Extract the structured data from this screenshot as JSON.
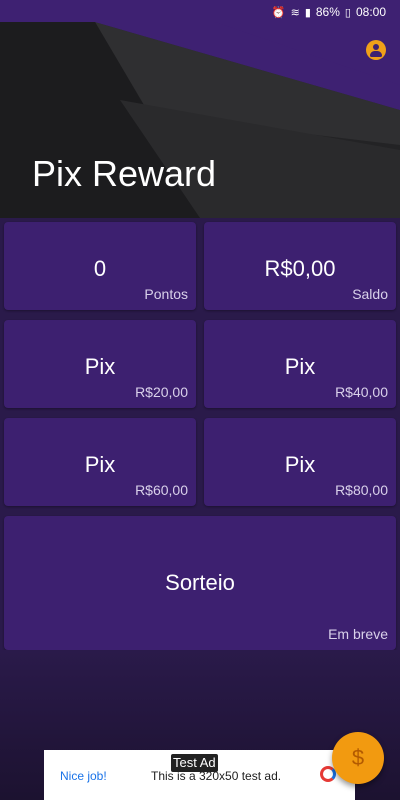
{
  "status_bar": {
    "battery": "86%",
    "time": "08:00"
  },
  "header": {
    "title": "Pix Reward"
  },
  "cards": {
    "points": {
      "value": "0",
      "label": "Pontos"
    },
    "balance": {
      "value": "R$0,00",
      "label": "Saldo"
    },
    "pix20": {
      "title": "Pix",
      "amount": "R$20,00"
    },
    "pix40": {
      "title": "Pix",
      "amount": "R$40,00"
    },
    "pix60": {
      "title": "Pix",
      "amount": "R$60,00"
    },
    "pix80": {
      "title": "Pix",
      "amount": "R$80,00"
    },
    "raffle": {
      "title": "Sorteio",
      "status": "Em breve"
    }
  },
  "ad": {
    "label": "Test Ad",
    "nice": "Nice job!",
    "message": "This is a 320x50 test ad."
  },
  "fab": {
    "icon": "$"
  },
  "colors": {
    "accent": "#f29a10",
    "card": "#3d2070",
    "background": "#2a1a4a"
  }
}
